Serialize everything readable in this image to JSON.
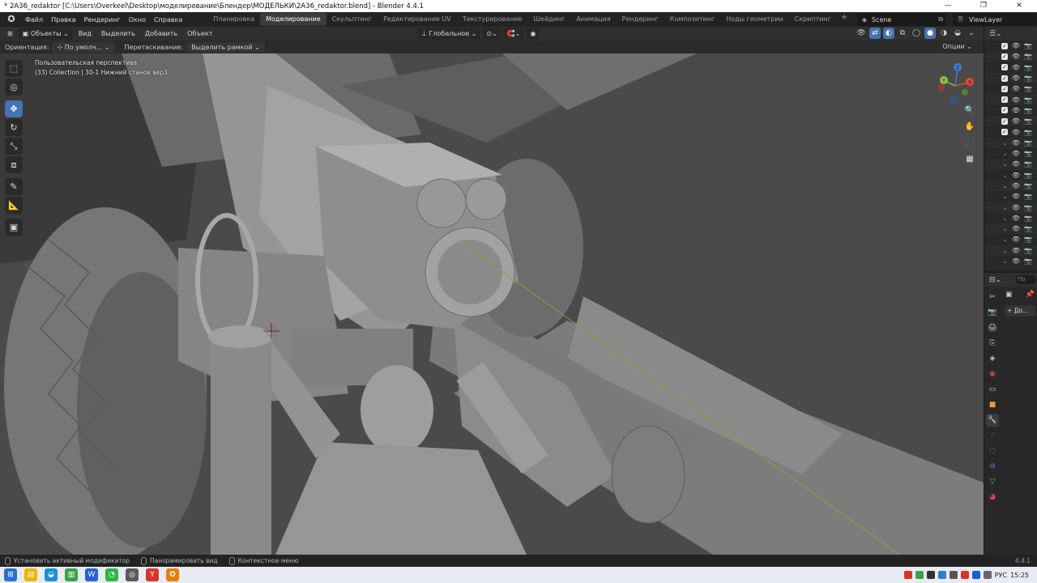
{
  "window": {
    "title": "* 2A36_redaktor [C:\\Users\\Overkeel\\Desktop\\моделирование\\Блендер\\МОДЕЛЬКИ\\2A36_redaktor.blend] - Blender 4.4.1",
    "minimize": "—",
    "maximize": "❐",
    "close": "✕"
  },
  "menubar": {
    "logo": "✪",
    "items": [
      "Файл",
      "Правка",
      "Рендеринг",
      "Окно",
      "Справка"
    ],
    "workspaces": [
      "Планировка",
      "Моделирование",
      "Скульптинг",
      "Редактирование UV",
      "Текстурирование",
      "Шейдинг",
      "Анимация",
      "Рендеринг",
      "Композитинг",
      "Ноды геометрии",
      "Скриптинг"
    ],
    "active_workspace": "Моделирование",
    "add_workspace": "+",
    "scene": "Scene",
    "view_layer": "ViewLayer"
  },
  "viewport_header": {
    "editor_icon": "⊞",
    "mode": "Объекты",
    "menus": [
      "Вид",
      "Выделить",
      "Добавить",
      "Объект"
    ],
    "transform_orientation": "Глобальное"
  },
  "tool_settings": {
    "orientation_label": "Ориентация:",
    "orientation_value": "По умолч...",
    "drag_label": "Перетаскивание:",
    "drag_value": "Выделить рамкой",
    "options": "Опции"
  },
  "viewport": {
    "perspective": "Пользовательская перспектива",
    "collection_info": "(33) Collection | 30-1 Нижний станок вер3",
    "gizmo": {
      "z": "Z",
      "y": "Y",
      "x": "X"
    }
  },
  "toolbar": {
    "tools": [
      {
        "name": "select-box",
        "glyph": "⬚"
      },
      {
        "name": "cursor",
        "glyph": "◎"
      },
      {
        "name": "move",
        "glyph": "✥"
      },
      {
        "name": "rotate",
        "glyph": "↻"
      },
      {
        "name": "scale",
        "glyph": "⤡"
      },
      {
        "name": "transform",
        "glyph": "⧈"
      },
      {
        "name": "annotate",
        "glyph": "✎"
      },
      {
        "name": "measure",
        "glyph": "📐"
      },
      {
        "name": "add-cube",
        "glyph": "▣"
      }
    ]
  },
  "nav_buttons": [
    "🔍",
    "✋",
    "🎥",
    "▦"
  ],
  "outliner": {
    "rows_checked": 9,
    "rows_unchecked": 12
  },
  "properties": {
    "search_placeholder": "По",
    "add_modifier": "+ До..."
  },
  "statusbar": {
    "items": [
      "Установить активный модификатор",
      "Панорамировать вид",
      "Контекстное меню"
    ],
    "version": "4.4.1"
  },
  "taskbar": {
    "language": "РУС",
    "time": "15:25"
  },
  "colors": {
    "accent": "#4772b3",
    "axis_x": "#e8453c",
    "axis_y": "#8cc63f",
    "axis_z": "#3f7fd1"
  }
}
